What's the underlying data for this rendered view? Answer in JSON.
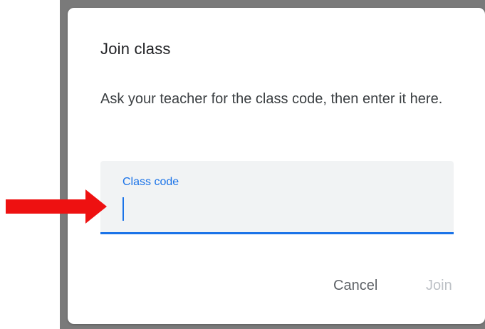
{
  "dialog": {
    "title": "Join class",
    "body": "Ask your teacher for the class code, then enter it here.",
    "field": {
      "label": "Class code",
      "value": "",
      "focused": true
    },
    "buttons": {
      "cancel_label": "Cancel",
      "join_label": "Join",
      "join_enabled": false
    }
  },
  "annotation": {
    "icon": "red-arrow-icon",
    "color": "#ee1111"
  },
  "colors": {
    "accent": "#1a73e8",
    "field_background": "#f1f3f4",
    "disabled_text": "#bdc1c6"
  }
}
